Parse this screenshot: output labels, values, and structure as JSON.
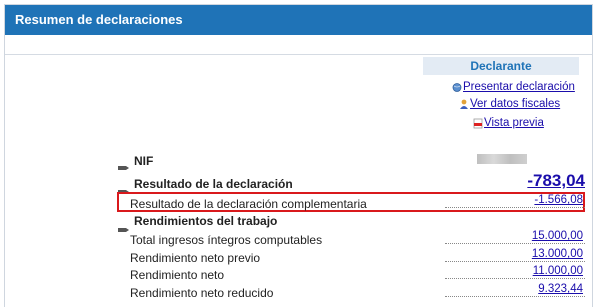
{
  "header": {
    "title": "Resumen de declaraciones"
  },
  "declarante": {
    "heading": "Declarante",
    "actions": {
      "presentar": "Presentar declaración",
      "ver_datos": "Ver datos fiscales",
      "vista_previa": "Vista previa"
    }
  },
  "rows": {
    "nif": {
      "label": "NIF"
    },
    "resultado": {
      "label": "Resultado de la declaración",
      "value": "-783,04"
    },
    "complementaria": {
      "label": "Resultado de la declaración complementaria",
      "value": "-1.566,08"
    },
    "rendimientos": {
      "label": "Rendimientos del trabajo"
    },
    "total_ingresos": {
      "label": "Total ingresos íntegros computables",
      "value": "15.000,00"
    },
    "neto_previo": {
      "label": "Rendimiento neto previo",
      "value": "13.000,00"
    },
    "neto": {
      "label": "Rendimiento neto",
      "value": "11.000,00"
    },
    "neto_reducido": {
      "label": "Rendimiento neto reducido",
      "value": "9.323,44"
    }
  },
  "colors": {
    "header": "#1f73b7",
    "link": "#1a0dab",
    "highlight": "#d9191c"
  }
}
